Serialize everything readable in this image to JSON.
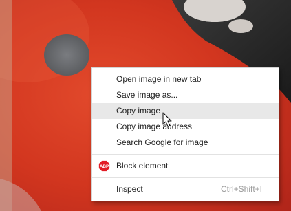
{
  "background": {
    "description_icon": "ladybug-photo"
  },
  "context_menu": {
    "items": [
      {
        "label": "Open image in new tab"
      },
      {
        "label": "Save image as..."
      },
      {
        "label": "Copy image"
      },
      {
        "label": "Copy image address"
      },
      {
        "label": "Search Google for image"
      }
    ],
    "block_element": {
      "label": "Block element",
      "icon": "abp-icon",
      "icon_text": "ABP"
    },
    "inspect": {
      "label": "Inspect",
      "shortcut": "Ctrl+Shift+I"
    },
    "hovered_item": "Copy image"
  },
  "colors": {
    "ladybug_red": "#d2361f",
    "spot_gray": "#6d6f72",
    "abp_red": "#e21c26",
    "menu_hover": "#e8e8e8"
  }
}
